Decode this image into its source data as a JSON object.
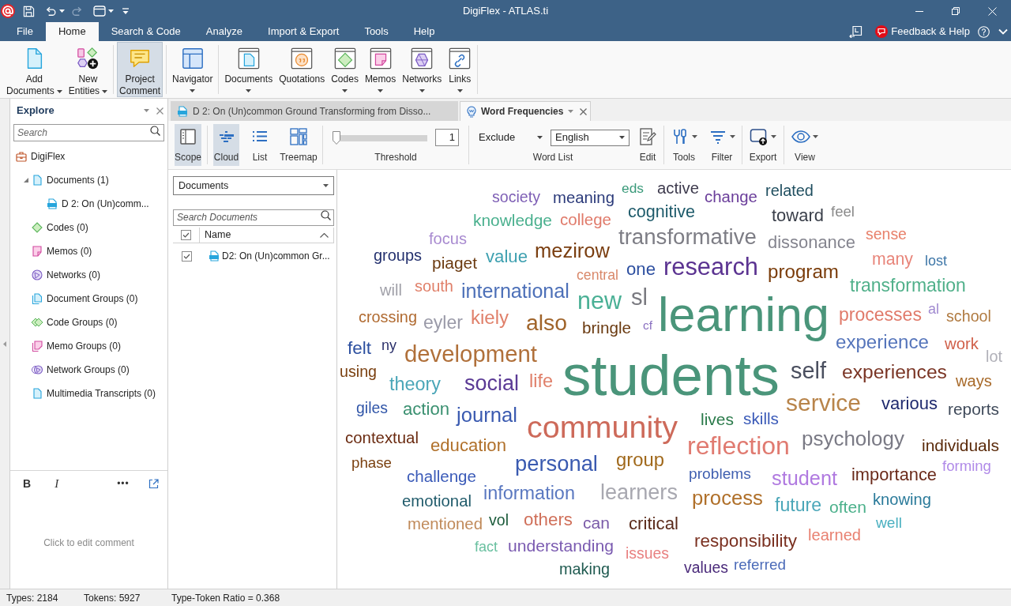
{
  "title_bar": {
    "title": "DigiFlex - ATLAS.ti"
  },
  "menu_tabs": [
    {
      "label": "File",
      "selected": false
    },
    {
      "label": "Home",
      "selected": true
    },
    {
      "label": "Search & Code",
      "selected": false
    },
    {
      "label": "Analyze",
      "selected": false
    },
    {
      "label": "Import & Export",
      "selected": false
    },
    {
      "label": "Tools",
      "selected": false
    },
    {
      "label": "Help",
      "selected": false
    }
  ],
  "help": {
    "label": "Feedback & Help"
  },
  "ribbon": {
    "groups": [
      {
        "buttons": [
          {
            "lines": [
              "Add",
              "Documents"
            ],
            "dropdown": true,
            "selected": false
          },
          {
            "lines": [
              "New",
              "Entities"
            ],
            "dropdown": true,
            "selected": false
          }
        ]
      },
      {
        "buttons": [
          {
            "lines": [
              "Project",
              "Comment"
            ],
            "dropdown": false,
            "selected": true
          }
        ]
      },
      {
        "buttons": [
          {
            "lines": [
              "Navigator"
            ],
            "dropdown": true,
            "selected": false
          }
        ]
      },
      {
        "buttons": [
          {
            "lines": [
              "Documents"
            ],
            "dropdown": true,
            "selected": false
          },
          {
            "lines": [
              "Quotations"
            ],
            "dropdown": false,
            "selected": false
          },
          {
            "lines": [
              "Codes"
            ],
            "dropdown": true,
            "selected": false
          },
          {
            "lines": [
              "Memos"
            ],
            "dropdown": true,
            "selected": false
          },
          {
            "lines": [
              "Networks"
            ],
            "dropdown": true,
            "selected": false
          },
          {
            "lines": [
              "Links"
            ],
            "dropdown": true,
            "selected": false
          }
        ]
      }
    ]
  },
  "explore": {
    "title": "Explore",
    "search_placeholder": "Search",
    "tree": [
      {
        "label": "DigiFlex",
        "kind": "project",
        "children": [
          {
            "label": "Documents (1)",
            "kind": "documents",
            "expanded": true,
            "children": [
              {
                "label": "D 2: On (Un)comm...",
                "kind": "pdf"
              }
            ]
          },
          {
            "label": "Codes (0)",
            "kind": "codes"
          },
          {
            "label": "Memos (0)",
            "kind": "memos"
          },
          {
            "label": "Networks (0)",
            "kind": "networks"
          },
          {
            "label": "Document Groups (0)",
            "kind": "docgroups"
          },
          {
            "label": "Code Groups (0)",
            "kind": "codegroups"
          },
          {
            "label": "Memo Groups (0)",
            "kind": "memogroups"
          },
          {
            "label": "Network Groups (0)",
            "kind": "netgroups"
          },
          {
            "label": "Multimedia Transcripts (0)",
            "kind": "transcripts"
          }
        ]
      }
    ],
    "comment_tools": [
      "B",
      "I",
      "•••"
    ],
    "comment": {
      "placeholder": "Click to edit comment"
    }
  },
  "doc_tabs": [
    {
      "label": "D 2: On (Un)common Ground Transforming from Disso...",
      "kind": "pdf",
      "selected": false
    },
    {
      "label": "Word Frequencies",
      "kind": "wordfreq",
      "selected": true
    }
  ],
  "toolbar": {
    "scope": {
      "label": "Scope",
      "selected": true
    },
    "views": [
      {
        "label": "Cloud",
        "selected": true
      },
      {
        "label": "List",
        "selected": false
      },
      {
        "label": "Treemap",
        "selected": false
      }
    ],
    "threshold": {
      "level": 0,
      "value": "1",
      "label": "Threshold"
    },
    "word_list": {
      "mode": "Exclude",
      "language": "English",
      "label": "Word List"
    },
    "edit": {
      "label": "Edit"
    },
    "tools": [
      {
        "label": "Tools"
      },
      {
        "label": "Filter"
      }
    ],
    "export": {
      "label": "Export"
    },
    "view": {
      "label": "View"
    }
  },
  "scope_panel": {
    "selector": "Documents",
    "search_placeholder": "Search Documents",
    "header": {
      "checked": true,
      "label": "Name"
    },
    "rows": [
      {
        "label": "D2: On (Un)common Gr...",
        "checked": true
      }
    ]
  },
  "word_cloud": {
    "words": [
      {
        "text": "society",
        "color": "#7e5fb5"
      },
      {
        "text": "meaning",
        "color": "#2b3a7a"
      },
      {
        "text": "eds",
        "color": "#3a9a7a"
      },
      {
        "text": "active",
        "color": "#3d3a4d"
      },
      {
        "text": "change",
        "color": "#6a3d9a"
      },
      {
        "text": "related",
        "color": "#1f4e5f"
      },
      {
        "text": "knowledge",
        "color": "#4ab08e"
      },
      {
        "text": "college",
        "color": "#e07a6a"
      },
      {
        "text": "cognitive",
        "color": "#1d5a6a"
      },
      {
        "text": "toward",
        "color": "#3a3f4a"
      },
      {
        "text": "feel",
        "color": "#8a8a8a"
      },
      {
        "text": "focus",
        "color": "#a88ad0"
      },
      {
        "text": "transformative",
        "color": "#7d7d85"
      },
      {
        "text": "dissonance",
        "color": "#85858f"
      },
      {
        "text": "sense",
        "color": "#e8806a"
      },
      {
        "text": "groups",
        "color": "#23306e"
      },
      {
        "text": "piaget",
        "color": "#6b3a10"
      },
      {
        "text": "value",
        "color": "#3ea0b0"
      },
      {
        "text": "mezirow",
        "color": "#7a3e10"
      },
      {
        "text": "many",
        "color": "#e8857a"
      },
      {
        "text": "lost",
        "color": "#3f77a8"
      },
      {
        "text": "central",
        "color": "#d9886a"
      },
      {
        "text": "one",
        "color": "#2d4fa0"
      },
      {
        "text": "research",
        "color": "#5b3391"
      },
      {
        "text": "program",
        "color": "#7a3c0a"
      },
      {
        "text": "will",
        "color": "#a0a0a8"
      },
      {
        "text": "south",
        "color": "#e0806a"
      },
      {
        "text": "international",
        "color": "#4d70b8"
      },
      {
        "text": "transformation",
        "color": "#50b08a"
      },
      {
        "text": "new",
        "color": "#4ab095"
      },
      {
        "text": "sl",
        "color": "#7a7a80"
      },
      {
        "text": "al",
        "color": "#a08ad0"
      },
      {
        "text": "crossing",
        "color": "#b06a30"
      },
      {
        "text": "eyler",
        "color": "#9a9aa8"
      },
      {
        "text": "kiely",
        "color": "#e0806a"
      },
      {
        "text": "also",
        "color": "#a0642a"
      },
      {
        "text": "bringle",
        "color": "#6a3a10"
      },
      {
        "text": "cf",
        "color": "#8a70c0"
      },
      {
        "text": "learning",
        "color": "#4a957a"
      },
      {
        "text": "processes",
        "color": "#e07a6a"
      },
      {
        "text": "school",
        "color": "#b07a40"
      },
      {
        "text": "felt",
        "color": "#2d50a0"
      },
      {
        "text": "ny",
        "color": "#2a2f6a"
      },
      {
        "text": "development",
        "color": "#b0703a"
      },
      {
        "text": "experience",
        "color": "#5575bb"
      },
      {
        "text": "work",
        "color": "#d0604a"
      },
      {
        "text": "lot",
        "color": "#b0b0b8"
      },
      {
        "text": "using",
        "color": "#7a4010"
      },
      {
        "text": "theory",
        "color": "#4aa6b8"
      },
      {
        "text": "social",
        "color": "#5b3a95"
      },
      {
        "text": "life",
        "color": "#e0806a"
      },
      {
        "text": "students",
        "color": "#4a957a"
      },
      {
        "text": "self",
        "color": "#4a4f5f"
      },
      {
        "text": "experiences",
        "color": "#7a3525"
      },
      {
        "text": "ways",
        "color": "#a86a2a"
      },
      {
        "text": "giles",
        "color": "#3055a8"
      },
      {
        "text": "action",
        "color": "#3a9070"
      },
      {
        "text": "journal",
        "color": "#3a5ab0"
      },
      {
        "text": "lives",
        "color": "#2a7a4a"
      },
      {
        "text": "skills",
        "color": "#3a5ab8"
      },
      {
        "text": "service",
        "color": "#b8844a"
      },
      {
        "text": "various",
        "color": "#1f2a6e"
      },
      {
        "text": "reports",
        "color": "#3f4a5a"
      },
      {
        "text": "contextual",
        "color": "#6a2a10"
      },
      {
        "text": "education",
        "color": "#b0702a"
      },
      {
        "text": "community",
        "color": "#cd6a5a"
      },
      {
        "text": "reflection",
        "color": "#e07a70"
      },
      {
        "text": "psychology",
        "color": "#7a7a85"
      },
      {
        "text": "individuals",
        "color": "#5a2a0a"
      },
      {
        "text": "phase",
        "color": "#7a4010"
      },
      {
        "text": "personal",
        "color": "#3a5ab0"
      },
      {
        "text": "group",
        "color": "#a0681a"
      },
      {
        "text": "forming",
        "color": "#b08ae8"
      },
      {
        "text": "challenge",
        "color": "#3a5ab8"
      },
      {
        "text": "problems",
        "color": "#3f5fb0"
      },
      {
        "text": "student",
        "color": "#b07ae0"
      },
      {
        "text": "importance",
        "color": "#6a2a1a"
      },
      {
        "text": "emotional",
        "color": "#1f5a6a"
      },
      {
        "text": "information",
        "color": "#5a78c0"
      },
      {
        "text": "learners",
        "color": "#a8a8b0"
      },
      {
        "text": "process",
        "color": "#b0702a"
      },
      {
        "text": "future",
        "color": "#4aa6b8"
      },
      {
        "text": "often",
        "color": "#4ab08a"
      },
      {
        "text": "knowing",
        "color": "#2a7a9a"
      },
      {
        "text": "mentioned",
        "color": "#c08a5a"
      },
      {
        "text": "vol",
        "color": "#1a5a3a"
      },
      {
        "text": "others",
        "color": "#d0705a"
      },
      {
        "text": "can",
        "color": "#7a5aa8"
      },
      {
        "text": "critical",
        "color": "#5a2a1a"
      },
      {
        "text": "well",
        "color": "#4ab0c0"
      },
      {
        "text": "fact",
        "color": "#6ac0a0"
      },
      {
        "text": "understanding",
        "color": "#7a5ab0"
      },
      {
        "text": "issues",
        "color": "#e88080"
      },
      {
        "text": "responsibility",
        "color": "#7a3020"
      },
      {
        "text": "learned",
        "color": "#e88070"
      },
      {
        "text": "making",
        "color": "#1f5a50"
      },
      {
        "text": "values",
        "color": "#4a2a7a"
      },
      {
        "text": "referred",
        "color": "#4a6ab8"
      }
    ]
  },
  "status_bar": [
    "Types: 2184",
    "Tokens: 5927",
    "Type-Token Ratio = 0.368"
  ]
}
